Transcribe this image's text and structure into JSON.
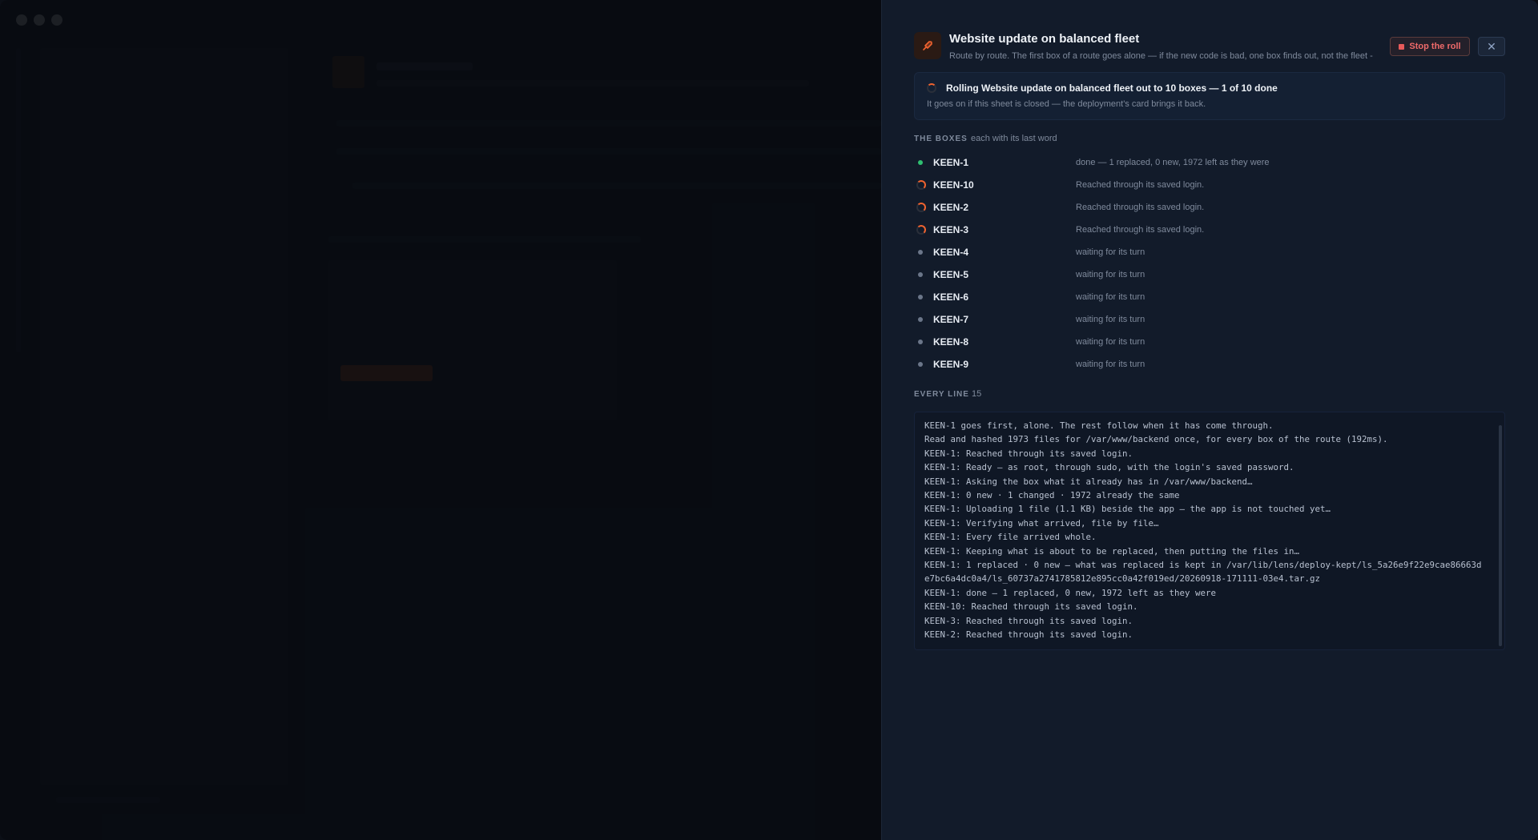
{
  "window": {
    "controls": [
      "close",
      "minimize",
      "maximize"
    ]
  },
  "sheet": {
    "icon": "rocket-icon",
    "title": "Website update on balanced fleet",
    "subtitle": "Route by route. The first box of a route goes alone — if the new code is bad, one box finds out, not the fleet -",
    "stop_label": "Stop the roll",
    "close_icon": "close-icon",
    "status": {
      "title": "Rolling Website update on balanced fleet out to 10 boxes — 1 of 10 done",
      "subtitle": "It goes on if this sheet is closed — the deployment's card brings it back."
    },
    "boxes_section": {
      "label": "THE BOXES",
      "hint": "each with its last word"
    },
    "boxes": [
      {
        "name": "KEEN-1",
        "state": "done",
        "note": "done — 1 replaced, 0 new, 1972 left as they were"
      },
      {
        "name": "KEEN-10",
        "state": "working",
        "note": "Reached through its saved login."
      },
      {
        "name": "KEEN-2",
        "state": "working",
        "note": "Reached through its saved login."
      },
      {
        "name": "KEEN-3",
        "state": "working",
        "note": "Reached through its saved login."
      },
      {
        "name": "KEEN-4",
        "state": "waiting",
        "note": "waiting for its turn"
      },
      {
        "name": "KEEN-5",
        "state": "waiting",
        "note": "waiting for its turn"
      },
      {
        "name": "KEEN-6",
        "state": "waiting",
        "note": "waiting for its turn"
      },
      {
        "name": "KEEN-7",
        "state": "waiting",
        "note": "waiting for its turn"
      },
      {
        "name": "KEEN-8",
        "state": "waiting",
        "note": "waiting for its turn"
      },
      {
        "name": "KEEN-9",
        "state": "waiting",
        "note": "waiting for its turn"
      }
    ],
    "log_section": {
      "label": "EVERY LINE",
      "count": "15"
    },
    "log": [
      "KEEN-1 goes first, alone. The rest follow when it has come through.",
      "Read and hashed 1973 files for /var/www/backend once, for every box of the route (192ms).",
      "KEEN-1: Reached through its saved login.",
      "KEEN-1: Ready — as root, through sudo, with the login's saved password.",
      "KEEN-1: Asking the box what it already has in /var/www/backend…",
      "KEEN-1: 0 new · 1 changed · 1972 already the same",
      "KEEN-1: Uploading 1 file (1.1 KB) beside the app — the app is not touched yet…",
      "KEEN-1: Verifying what arrived, file by file…",
      "KEEN-1: Every file arrived whole.",
      "KEEN-1: Keeping what is about to be replaced, then putting the files in…",
      "KEEN-1: 1 replaced · 0 new — what was replaced is kept in /var/lib/lens/deploy-kept/ls_5a26e9f22e9cae86663de7bc6a4dc0a4/ls_60737a2741785812e895cc0a42f019ed/20260918-171111-03e4.tar.gz",
      "KEEN-1: done — 1 replaced, 0 new, 1972 left as they were",
      "KEEN-10: Reached through its saved login.",
      "KEEN-3: Reached through its saved login.",
      "KEEN-2: Reached through its saved login."
    ]
  },
  "colors": {
    "accent": "#f0632f",
    "done": "#2fbf71",
    "waiting": "#6b7689",
    "stop": "#ef6a6a"
  }
}
